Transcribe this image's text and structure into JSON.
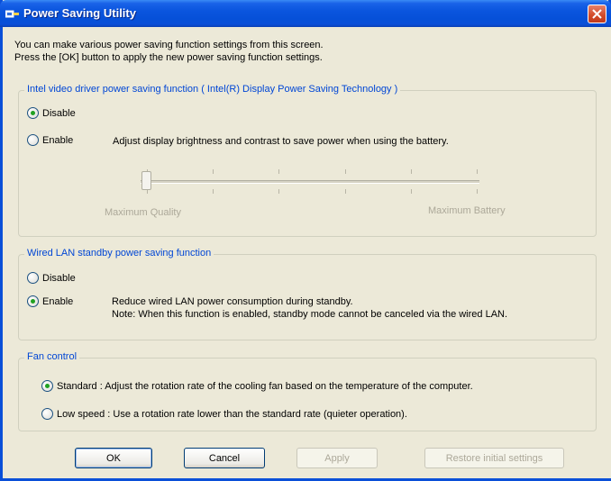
{
  "window": {
    "title": "Power Saving Utility"
  },
  "intro": {
    "line1": "You can make various power saving function settings from this screen.",
    "line2": "Press the [OK] button to apply the new power saving function settings."
  },
  "video": {
    "legend": "Intel video driver power saving function ( Intel(R) Display Power Saving Technology )",
    "disable_label": "Disable",
    "enable_label": "Enable",
    "enable_desc": "Adjust display brightness and contrast to save power when using the battery.",
    "selected": "disable",
    "slider": {
      "min_label": "Maximum Quality",
      "max_label": "Maximum Battery",
      "ticks": 6,
      "value": 0
    }
  },
  "lan": {
    "legend": "Wired LAN standby power saving function",
    "disable_label": "Disable",
    "enable_label": "Enable",
    "enable_desc1": "Reduce wired LAN power consumption during standby.",
    "enable_desc2": "Note: When this function is enabled, standby mode cannot be canceled via the wired LAN.",
    "selected": "enable"
  },
  "fan": {
    "legend": "Fan control",
    "standard_label": "Standard : Adjust the rotation rate of the cooling fan based on the temperature of the computer.",
    "low_label": "Low speed : Use a rotation rate lower than the standard rate (quieter operation).",
    "selected": "standard"
  },
  "buttons": {
    "ok": "OK",
    "cancel": "Cancel",
    "apply": "Apply",
    "restore": "Restore initial settings"
  },
  "colors": {
    "legend_blue": "#0046d5",
    "radio_green": "#21a121",
    "title_blue": "#0a4fd8",
    "dialog_bg": "#ece9d8"
  }
}
